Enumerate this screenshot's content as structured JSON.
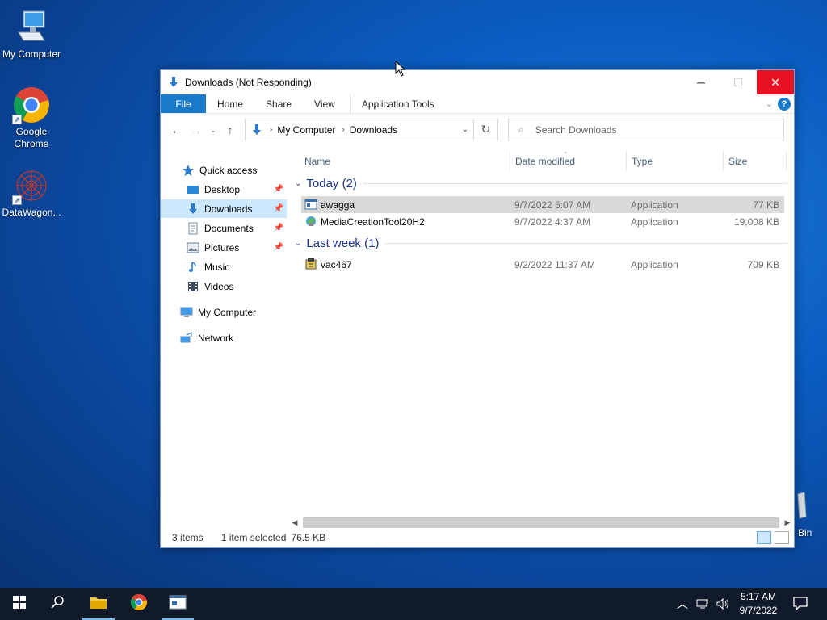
{
  "desktop": {
    "icons": [
      {
        "label": "My Computer"
      },
      {
        "label": "Google Chrome"
      },
      {
        "label": "DataWagon..."
      }
    ],
    "recycle_bin_label": "Bin"
  },
  "window": {
    "title": "Downloads (Not Responding)",
    "ribbon_tabs": [
      "File",
      "Home",
      "Share",
      "View",
      "Application Tools"
    ],
    "address": {
      "crumbs": [
        "My Computer",
        "Downloads"
      ]
    },
    "search_placeholder": "Search Downloads",
    "sidebar": {
      "quick_access": "Quick access",
      "items": [
        {
          "label": "Desktop",
          "pinned": true
        },
        {
          "label": "Downloads",
          "pinned": true,
          "selected": true
        },
        {
          "label": "Documents",
          "pinned": true
        },
        {
          "label": "Pictures",
          "pinned": true
        },
        {
          "label": "Music",
          "pinned": false
        },
        {
          "label": "Videos",
          "pinned": false
        }
      ],
      "my_computer": "My Computer",
      "network": "Network"
    },
    "columns": [
      "Name",
      "Date modified",
      "Type",
      "Size"
    ],
    "groups": [
      {
        "label": "Today (2)",
        "files": [
          {
            "name": "awagga",
            "date": "9/7/2022 5:07 AM",
            "type": "Application",
            "size": "77 KB",
            "selected": true
          },
          {
            "name": "MediaCreationTool20H2",
            "date": "9/7/2022 4:37 AM",
            "type": "Application",
            "size": "19,008 KB",
            "selected": false
          }
        ]
      },
      {
        "label": "Last week (1)",
        "files": [
          {
            "name": "vac467",
            "date": "9/2/2022 11:37 AM",
            "type": "Application",
            "size": "709 KB",
            "selected": false
          }
        ]
      }
    ],
    "status": {
      "items": "3 items",
      "selected": "1 item selected",
      "size": "76.5 KB"
    }
  },
  "taskbar": {
    "time": "5:17 AM",
    "date": "9/7/2022"
  },
  "colors": {
    "accent": "#1979ca",
    "close": "#e81123",
    "selection": "#cce8ff"
  }
}
